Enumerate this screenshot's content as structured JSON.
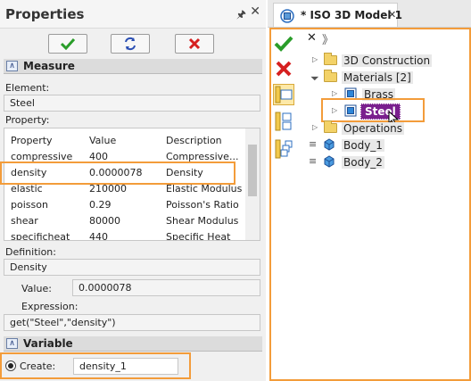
{
  "properties": {
    "title": "Properties",
    "measure_section": "Measure",
    "element_label": "Element:",
    "element_value": "Steel",
    "property_label": "Property:",
    "columns": [
      "Property",
      "Value",
      "Description"
    ],
    "rows": [
      {
        "property": "compressive",
        "value": "400",
        "description": "Compressive..."
      },
      {
        "property": "density",
        "value": "0.0000078",
        "description": "Density"
      },
      {
        "property": "elastic",
        "value": "210000",
        "description": "Elastic Modulus"
      },
      {
        "property": "poisson",
        "value": "0.29",
        "description": "Poisson's Ratio"
      },
      {
        "property": "shear",
        "value": "80000",
        "description": "Shear Modulus"
      },
      {
        "property": "specificheat",
        "value": "440",
        "description": "Specific Heat"
      }
    ],
    "definition_label": "Definition:",
    "definition_value": "Density",
    "value_label": "Value:",
    "value_value": "0.0000078",
    "expression_label": "Expression:",
    "expression_value": "get(\"Steel\",\"density\")",
    "variable_section": "Variable",
    "create_label": "Create:",
    "create_value": "density_1"
  },
  "model": {
    "tab_title": "* ISO 3D Model 1",
    "tree": {
      "construction": "3D Construction",
      "materials": "Materials [2]",
      "brass": "Brass",
      "steel": "Steel",
      "operations": "Operations",
      "body1": "Body_1",
      "body2": "Body_2"
    }
  },
  "colors": {
    "highlight": "#f39c3a",
    "selection": "#7a1f8e",
    "ok": "#2a9d2a",
    "cancel": "#d62020"
  }
}
